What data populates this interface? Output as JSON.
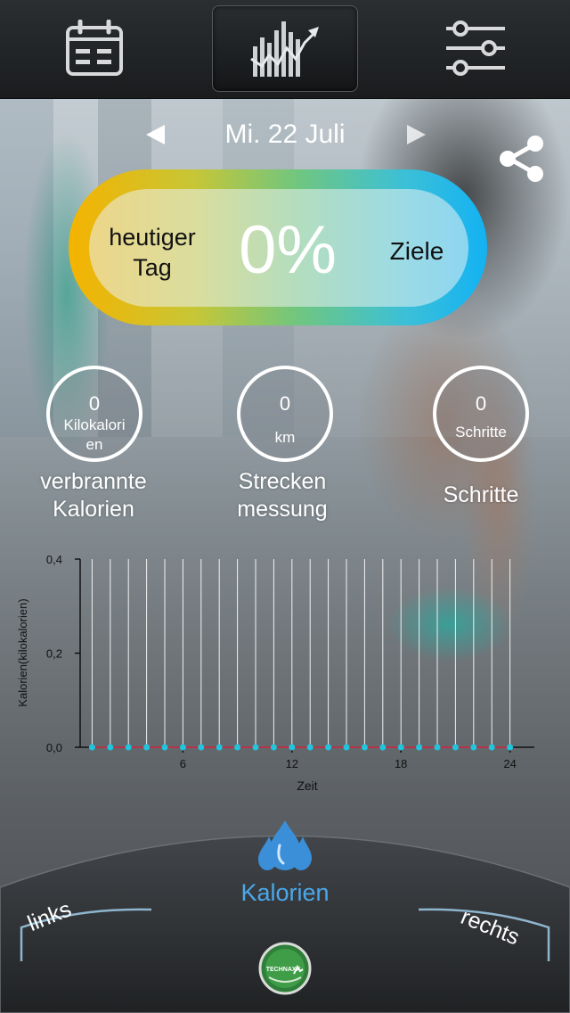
{
  "header": {
    "buttons": [
      {
        "icon": "calendar-icon"
      },
      {
        "icon": "stats-chart-icon",
        "active": true
      },
      {
        "icon": "settings-sliders-icon"
      }
    ]
  },
  "date_nav": {
    "date": "Mi. 22 Juli",
    "prev_icon": "triangle-left-icon",
    "next_icon": "triangle-right-icon"
  },
  "share_icon": "share-icon",
  "goal": {
    "left_label": "heutiger\nTag",
    "percent": "0%",
    "right_label": "Ziele",
    "gradient_colors": [
      "#f5b300",
      "#6fc680",
      "#13b2f3"
    ]
  },
  "stats": [
    {
      "value": "0",
      "unit": "Kilokalori\nen",
      "label": "verbrannte\nKalorien"
    },
    {
      "value": "0",
      "unit": "km",
      "label": "Strecken\nmessung"
    },
    {
      "value": "0",
      "unit": "Schritte",
      "label": "Schritte"
    }
  ],
  "chart_data": {
    "type": "line",
    "xlabel": "Zeit",
    "ylabel": "Kalorien(kilokalorien)",
    "xlim": [
      0,
      25
    ],
    "ylim": [
      0,
      0.4
    ],
    "x_ticks": [
      6,
      12,
      18,
      24
    ],
    "y_ticks": [
      "0,0",
      "0,2",
      "0,4"
    ],
    "y_tick_values": [
      0,
      0.2,
      0.4
    ],
    "x": [
      1,
      2,
      3,
      4,
      5,
      6,
      7,
      8,
      9,
      10,
      11,
      12,
      13,
      14,
      15,
      16,
      17,
      18,
      19,
      20,
      21,
      22,
      23,
      24
    ],
    "values": [
      0,
      0,
      0,
      0,
      0,
      0,
      0,
      0,
      0,
      0,
      0,
      0,
      0,
      0,
      0,
      0,
      0,
      0,
      0,
      0,
      0,
      0,
      0,
      0
    ],
    "point_color": "#20c4dc",
    "line_color": "#b8324a",
    "grid": "vertical"
  },
  "bottom": {
    "title": "Kalorien",
    "title_icon": "water-drop-icon",
    "left": "links",
    "right": "rechts",
    "logo": "TECHNAXX",
    "accent": "#4aa8ea"
  }
}
